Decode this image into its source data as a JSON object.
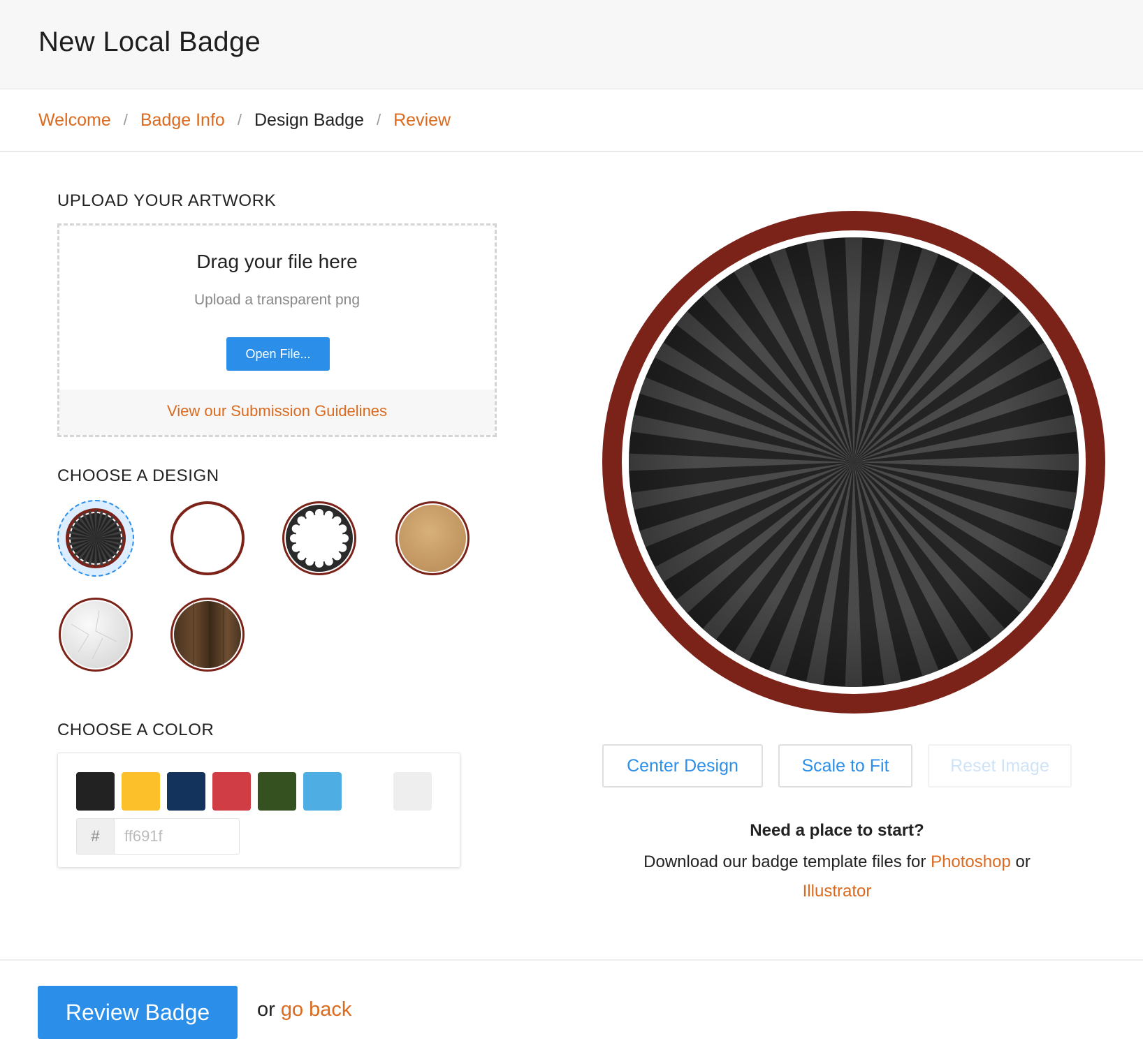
{
  "header": {
    "title": "New Local Badge"
  },
  "breadcrumb": {
    "items": [
      {
        "label": "Welcome",
        "current": false
      },
      {
        "label": "Badge Info",
        "current": false
      },
      {
        "label": "Design Badge",
        "current": true
      },
      {
        "label": "Review",
        "current": false
      }
    ],
    "separator": "/"
  },
  "upload": {
    "title": "UPLOAD YOUR ARTWORK",
    "drag_text": "Drag your file here",
    "hint_text": "Upload a transparent png",
    "open_button": "Open File...",
    "guidelines_link": "View our Submission Guidelines"
  },
  "design": {
    "title": "CHOOSE A DESIGN",
    "options": [
      {
        "name": "sunburst",
        "selected": true
      },
      {
        "name": "plain-white",
        "selected": false
      },
      {
        "name": "scalloped",
        "selected": false
      },
      {
        "name": "kraft-paper",
        "selected": false
      },
      {
        "name": "crumpled-paper",
        "selected": false
      },
      {
        "name": "wood",
        "selected": false
      }
    ]
  },
  "color": {
    "title": "CHOOSE A COLOR",
    "swatches": [
      "#222222",
      "#fcc12a",
      "#13335d",
      "#d13d44",
      "#34511f",
      "#4eaee3"
    ],
    "extra_swatch": "#eeeeee",
    "hex_prefix": "#",
    "hex_placeholder": "ff691f",
    "hex_value": ""
  },
  "preview": {
    "ring_color": "#7b2219",
    "background": "#232323",
    "ray_color": "#4a4a4a"
  },
  "tools": {
    "center": "Center Design",
    "scale": "Scale to Fit",
    "reset": "Reset Image"
  },
  "start": {
    "title": "Need a place to start?",
    "text_before": "Download our badge template files for ",
    "photoshop": "Photoshop",
    "text_middle": " or",
    "illustrator": "Illustrator"
  },
  "footer": {
    "review_button": "Review Badge",
    "or_text": "or ",
    "back_link": "go back"
  },
  "colors": {
    "accent": "#2b8ee8",
    "link": "#dc6a1e"
  }
}
